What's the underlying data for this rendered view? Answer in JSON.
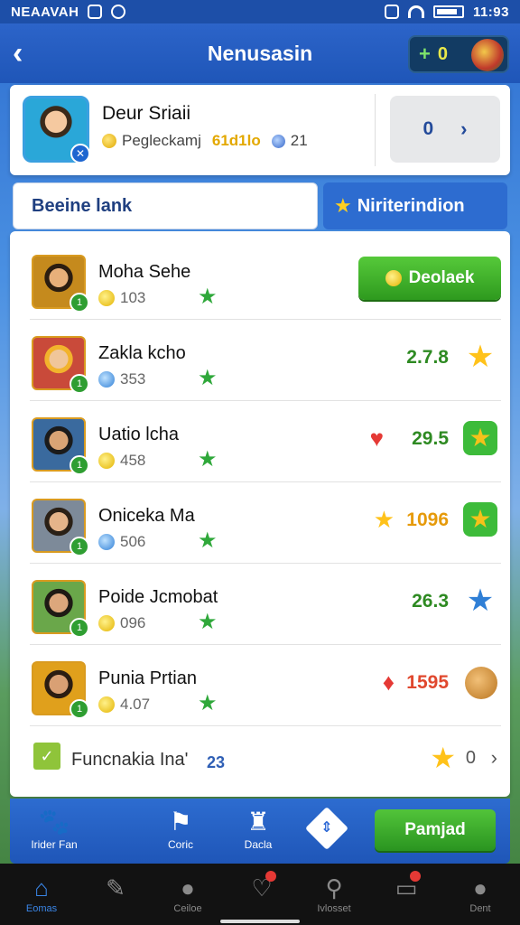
{
  "status_bar": {
    "left_text": "NEAAVAH",
    "time": "11:93"
  },
  "header": {
    "title": "Nenusasin",
    "coin_plus": "+",
    "coin_count": "0"
  },
  "profile": {
    "name": "Deur Sriaii",
    "subtitle": "Pegleckamj",
    "gold_value": "61d1lo",
    "gem_value": "21",
    "rank_value": "0"
  },
  "tabs": [
    {
      "label": "Beeine lank",
      "active": true
    },
    {
      "label": "Niriterindion",
      "active": false
    }
  ],
  "rows": [
    {
      "name": "Moha Sehe",
      "stat": "103",
      "stat_icon": "coin-icon",
      "action_label": "Deolaek"
    },
    {
      "name": "Zakla kcho",
      "stat": "353",
      "stat_icon": "gem-icon",
      "value": "2.7.8",
      "badge_icon": "gold-star-icon"
    },
    {
      "name": "Uatio lcha",
      "stat": "458",
      "stat_icon": "coin-icon",
      "value": "29.5",
      "pre_icon": "heart-icon",
      "badge_icon": "green-star-badge-icon"
    },
    {
      "name": "Onicekа Ma",
      "stat": "506",
      "stat_icon": "gem-icon",
      "value": "1096",
      "pre_icon": "gold-star-icon",
      "badge_icon": "green-star-badge-icon"
    },
    {
      "name": "Poide Jcmobat",
      "stat": "096",
      "stat_icon": "coin-icon",
      "value": "26.3",
      "badge_icon": "blue-star-icon"
    },
    {
      "name": "Punia Prtian",
      "stat": "4.07",
      "stat_icon": "coin-icon",
      "value": "1595",
      "pre_icon": "ruby-icon",
      "badge_icon": "bronze-medal-icon"
    }
  ],
  "footer_row": {
    "label": "Funcnakia Ina'",
    "number": "23",
    "count": "0"
  },
  "action_bar": {
    "items": [
      {
        "label": "Irider Fan"
      },
      {
        "label": "Coric"
      },
      {
        "label": "Dacla"
      }
    ],
    "primary_label": "Pamjad"
  },
  "bottom_nav": [
    {
      "label": "Eomas"
    },
    {
      "label": ""
    },
    {
      "label": "Ceiloe"
    },
    {
      "label": ""
    },
    {
      "label": "Ivlosset"
    },
    {
      "label": ""
    },
    {
      "label": "Dent"
    }
  ],
  "colors": {
    "accent": "#2d6cd0",
    "positive": "#2e8a22",
    "button_green": "#3fae2a",
    "warning": "#e69a0a"
  }
}
